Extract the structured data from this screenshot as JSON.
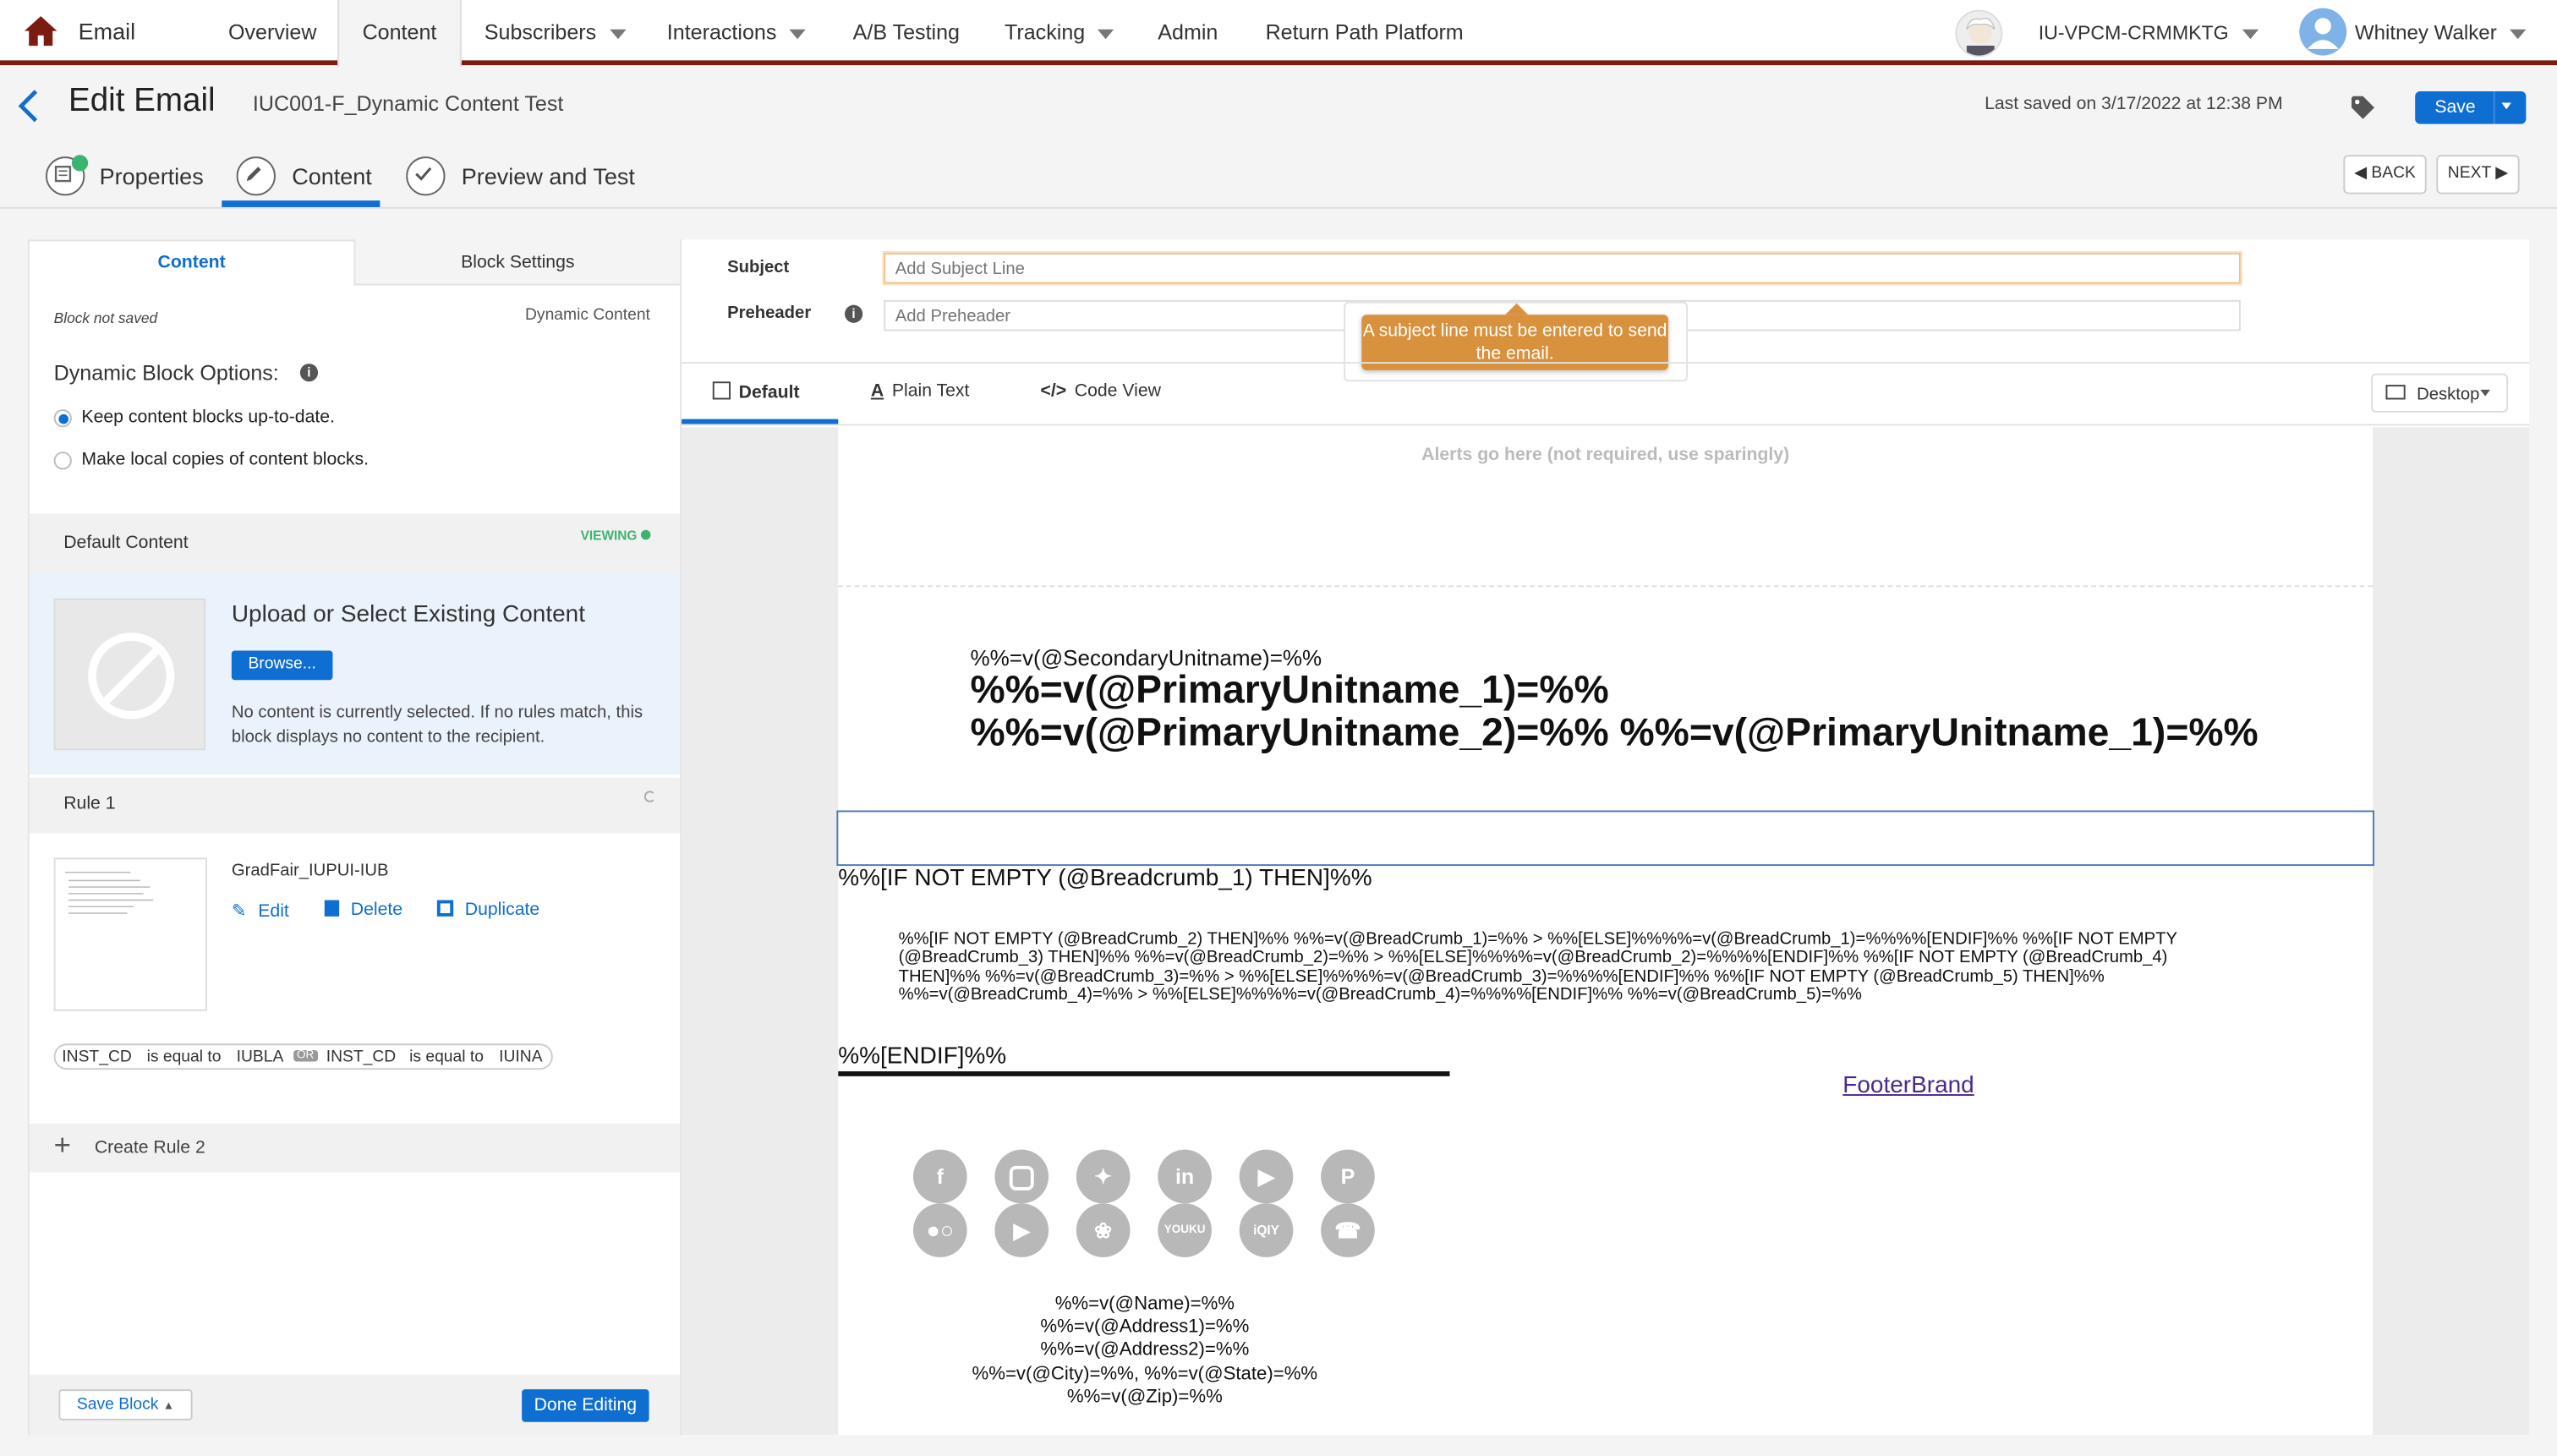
{
  "app": {
    "name": "Email"
  },
  "nav": {
    "items": [
      {
        "label": "Overview"
      },
      {
        "label": "Content"
      },
      {
        "label": "Subscribers"
      },
      {
        "label": "Interactions"
      },
      {
        "label": "A/B Testing"
      },
      {
        "label": "Tracking"
      },
      {
        "label": "Admin"
      },
      {
        "label": "Return Path Platform"
      }
    ],
    "business_unit": "IU-VPCM-CRMMKTG",
    "user": "Whitney Walker"
  },
  "header": {
    "title": "Edit Email",
    "email_name": "IUC001-F_Dynamic Content Test",
    "last_saved": "Last saved on 3/17/2022 at 12:38 PM",
    "save_label": "Save"
  },
  "steps": {
    "items": [
      {
        "label": "Properties"
      },
      {
        "label": "Content"
      },
      {
        "label": "Preview and Test"
      }
    ],
    "back_label": "BACK",
    "next_label": "NEXT"
  },
  "left_panel": {
    "tabs": [
      {
        "label": "Content"
      },
      {
        "label": "Block Settings"
      }
    ],
    "block_status": "Block not saved",
    "block_type": "Dynamic Content",
    "options_title": "Dynamic Block Options:",
    "option_keep": "Keep content blocks up-to-date.",
    "option_local": "Make local copies of content blocks.",
    "default_content": "Default Content",
    "viewing": "VIEWING",
    "upload_title": "Upload or Select Existing Content",
    "browse_label": "Browse...",
    "no_content_text": "No content is currently selected. If no rules match, this block displays no content to the recipient.",
    "rule_title": "Rule 1",
    "rule_content_name": "GradFair_IUPUI-IUB",
    "edit_label": "Edit",
    "delete_label": "Delete",
    "duplicate_label": "Duplicate",
    "condition": {
      "field1": "INST_CD",
      "op1": "is equal to",
      "val1": "IUBLA",
      "joiner": "OR",
      "field2": "INST_CD",
      "op2": "is equal to",
      "val2": "IUINA"
    },
    "create_rule": "Create Rule 2",
    "save_block": "Save Block",
    "done_editing": "Done Editing"
  },
  "right_panel": {
    "subject_label": "Subject",
    "subject_placeholder": "Add Subject Line",
    "preheader_label": "Preheader",
    "preheader_placeholder": "Add Preheader",
    "tooltip": "A subject line must be entered to send the email.",
    "view_tabs": [
      {
        "label": "Default"
      },
      {
        "label": "Plain Text"
      },
      {
        "label": "Code View"
      }
    ],
    "device": "Desktop"
  },
  "email": {
    "alerts": "Alerts go here (not required, use sparingly)",
    "secondary_unit": "%%=v(@SecondaryUnitname)=%%",
    "primary_unit_1": "%%=v(@PrimaryUnitname_1)=%%",
    "primary_unit_2": "%%=v(@PrimaryUnitname_2)=%% %%=v(@PrimaryUnitname_1)=%%",
    "breadcrumb_if": "%%[IF NOT EMPTY (@Breadcrumb_1) THEN]%%",
    "breadcrumb_body_1": "%%[IF NOT EMPTY (@BreadCrumb_2) THEN]%% %%=v(@BreadCrumb_1)=%% > %%[ELSE]%%%%=v(@BreadCrumb_1)=%%%%[ENDIF]%% %%[IF NOT EMPTY",
    "breadcrumb_body_2": "(@BreadCrumb_3) THEN]%% %%=v(@BreadCrumb_2)=%% > %%[ELSE]%%%%=v(@BreadCrumb_2)=%%%%[ENDIF]%% %%[IF NOT EMPTY (@BreadCrumb_4)",
    "breadcrumb_body_3": "THEN]%% %%=v(@BreadCrumb_3)=%% > %%[ELSE]%%%%=v(@BreadCrumb_3)=%%%%[ENDIF]%% %%[IF NOT EMPTY (@BreadCrumb_5) THEN]%%",
    "breadcrumb_body_4": "%%=v(@BreadCrumb_4)=%% > %%[ELSE]%%%%=v(@BreadCrumb_4)=%%%%[ENDIF]%% %%=v(@BreadCrumb_5)=%%",
    "endif": "%%[ENDIF]%%",
    "footer_brand": "FooterBrand",
    "social_row1": [
      "facebook-icon",
      "instagram-icon",
      "twitter-icon",
      "linkedin-icon",
      "youtube-icon",
      "pinterest-icon"
    ],
    "social_row2": [
      "flickr-icon",
      "youtube-alt-icon",
      "weibo-icon",
      "youku-icon",
      "iqiyi-icon",
      "whatsapp-icon"
    ],
    "address": [
      "%%=v(@Name)=%%",
      "%%=v(@Address1)=%%",
      "%%=v(@Address2)=%%",
      "%%=v(@City)=%%, %%=v(@State)=%%",
      "%%=v(@Zip)=%%"
    ]
  },
  "colors": {
    "accent": "#0e6ed1",
    "brand_bar": "#7a1c12",
    "tooltip": "#d8913c",
    "viewing": "#3cb371"
  }
}
